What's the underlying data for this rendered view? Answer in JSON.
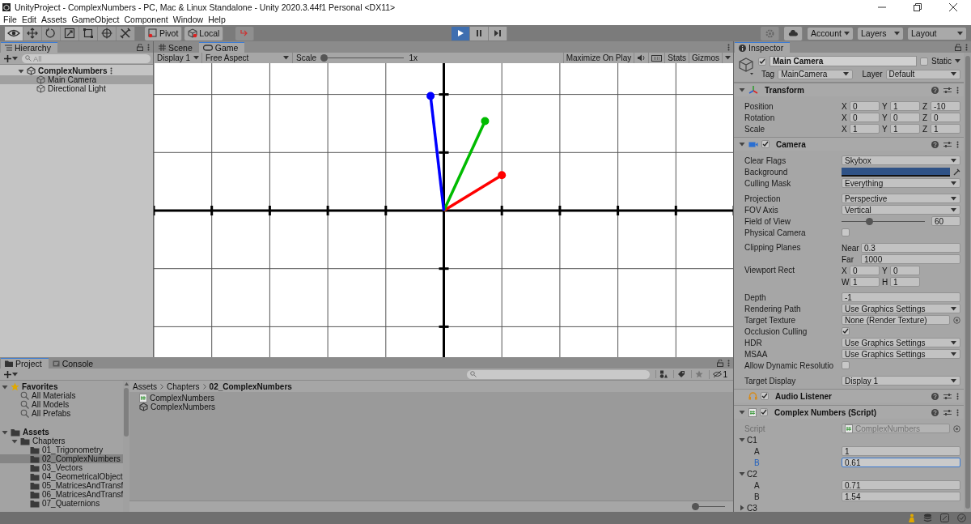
{
  "window": {
    "title": "UnityProject - ComplexNumbers - PC, Mac & Linux Standalone - Unity 2020.3.44f1 Personal <DX11>"
  },
  "menu": [
    "File",
    "Edit",
    "Assets",
    "GameObject",
    "Component",
    "Window",
    "Help"
  ],
  "toolbar": {
    "tools": [
      {
        "kind": "eye",
        "selected": true
      },
      {
        "kind": "move",
        "selected": false
      },
      {
        "kind": "rotate",
        "selected": false
      },
      {
        "kind": "scale",
        "selected": false
      },
      {
        "kind": "rect",
        "selected": false
      },
      {
        "kind": "transform",
        "selected": false
      },
      {
        "kind": "custom",
        "selected": false
      }
    ],
    "pivot": "Pivot",
    "local": "Local",
    "play": [
      {
        "kind": "play",
        "selected": true
      },
      {
        "kind": "pause",
        "selected": false
      },
      {
        "kind": "step",
        "selected": false
      }
    ],
    "menus": [
      "Account",
      "Layers",
      "Layout"
    ]
  },
  "hierarchy": {
    "tab": "Hierarchy",
    "search_placeholder": "All",
    "tree": [
      {
        "label": "ComplexNumbers",
        "kind": "scene",
        "expanded": true,
        "selected": false,
        "children": [
          {
            "label": "Main Camera",
            "kind": "object",
            "selected": true
          },
          {
            "label": "Directional Light",
            "kind": "object",
            "selected": false
          }
        ]
      }
    ]
  },
  "game": {
    "tabs": [
      {
        "label": "Scene",
        "kind": "grid",
        "selected": false
      },
      {
        "label": "Game",
        "kind": "gamepad",
        "selected": true
      }
    ],
    "display": "Display 1",
    "aspect": "Free Aspect",
    "scale_label": "Scale",
    "scale": {
      "level": 0
    },
    "scale_value": "1x",
    "maximize": "Maximize On Play",
    "stats": "Stats",
    "gizmos": "Gizmos"
  },
  "inspector": {
    "tab": "Inspector",
    "object": {
      "active": true,
      "name": "Main Camera",
      "static": false,
      "static_label": "Static",
      "tag_label": "Tag",
      "tag": "MainCamera",
      "layer_label": "Layer",
      "layer": "Default"
    },
    "components": [
      {
        "title": "Transform",
        "kind": "transform",
        "expanded": true,
        "sections": [
          {
            "rows": [
              {
                "kind": "vector",
                "label": "Position",
                "axes": [
                  {
                    "axis": "X",
                    "value": "0"
                  },
                  {
                    "axis": "Y",
                    "value": "1"
                  },
                  {
                    "axis": "Z",
                    "value": "-10"
                  }
                ]
              },
              {
                "kind": "vector",
                "label": "Rotation",
                "axes": [
                  {
                    "axis": "X",
                    "value": "0"
                  },
                  {
                    "axis": "Y",
                    "value": "0"
                  },
                  {
                    "axis": "Z",
                    "value": "0"
                  }
                ]
              },
              {
                "kind": "vector",
                "label": "Scale",
                "axes": [
                  {
                    "axis": "X",
                    "value": "1"
                  },
                  {
                    "axis": "Y",
                    "value": "1"
                  },
                  {
                    "axis": "Z",
                    "value": "1"
                  }
                ]
              }
            ]
          }
        ]
      },
      {
        "title": "Camera",
        "kind": "camera",
        "enabled": true,
        "expanded": true,
        "sections": [
          {
            "rows": [
              {
                "kind": "dropdown",
                "label": "Clear Flags",
                "value": "Skybox"
              },
              {
                "kind": "color",
                "label": "Background",
                "color": "#2f5286"
              },
              {
                "kind": "dropdown",
                "label": "Culling Mask",
                "value": "Everything"
              }
            ]
          },
          {
            "rows": [
              {
                "kind": "dropdown",
                "label": "Projection",
                "value": "Perspective"
              },
              {
                "kind": "dropdown",
                "label": "FOV Axis",
                "value": "Vertical"
              },
              {
                "kind": "slider",
                "label": "Field of View",
                "level": 0.33,
                "value": "60"
              },
              {
                "kind": "checkbox",
                "label": "Physical Camera",
                "checked": false
              }
            ]
          },
          {
            "rows": [
              {
                "kind": "pair",
                "label": "Clipping Planes",
                "fields": [
                  {
                    "label": "Near",
                    "value": "0.3"
                  },
                  {
                    "label": "Far",
                    "value": "1000"
                  }
                ]
              },
              {
                "kind": "rect",
                "label": "Viewport Rect",
                "fields": [
                  {
                    "label": "X",
                    "value": "0"
                  },
                  {
                    "label": "Y",
                    "value": "0"
                  },
                  {
                    "label": "W",
                    "value": "1"
                  },
                  {
                    "label": "H",
                    "value": "1"
                  }
                ]
              }
            ]
          },
          {
            "rows": [
              {
                "kind": "field",
                "label": "Depth",
                "value": "-1",
                "focused": false
              },
              {
                "kind": "dropdown",
                "label": "Rendering Path",
                "value": "Use Graphics Settings"
              },
              {
                "kind": "object",
                "label": "Target Texture",
                "value": "None (Render Texture)",
                "disabled": false
              },
              {
                "kind": "checkbox",
                "label": "Occlusion Culling",
                "checked": true
              },
              {
                "kind": "dropdown",
                "label": "HDR",
                "value": "Use Graphics Settings"
              },
              {
                "kind": "dropdown",
                "label": "MSAA",
                "value": "Use Graphics Settings"
              },
              {
                "kind": "checkbox",
                "label": "Allow Dynamic Resolutio",
                "checked": false
              }
            ]
          },
          {
            "rows": [
              {
                "kind": "dropdown",
                "label": "Target Display",
                "value": "Display 1"
              }
            ]
          }
        ]
      },
      {
        "title": "Audio Listener",
        "kind": "audio",
        "enabled": true
      },
      {
        "title": "Complex Numbers (Script)",
        "kind": "script",
        "enabled": true,
        "expanded": true,
        "sections": [
          {
            "rows": [
              {
                "kind": "object",
                "label": "Script",
                "value": "ComplexNumbers",
                "disabled": true
              },
              {
                "kind": "foldout",
                "label": "C1",
                "expanded": true,
                "children": [
                  {
                    "kind": "field",
                    "label": "A",
                    "value": "1",
                    "focused": false
                  },
                  {
                    "kind": "field",
                    "label": "B",
                    "value": "0.61",
                    "focused": true
                  }
                ]
              },
              {
                "kind": "foldout",
                "label": "C2",
                "expanded": true,
                "children": [
                  {
                    "kind": "field",
                    "label": "A",
                    "value": "0.71",
                    "focused": false
                  },
                  {
                    "kind": "field",
                    "label": "B",
                    "value": "1.54",
                    "focused": false
                  }
                ]
              },
              {
                "kind": "foldout",
                "label": "C3",
                "expanded": false
              }
            ]
          }
        ]
      }
    ]
  },
  "project": {
    "tabs": [
      {
        "label": "Project",
        "selected": true
      },
      {
        "label": "Console",
        "selected": false
      }
    ],
    "tree": [
      {
        "label": "Favorites",
        "kind": "favorites",
        "expanded": true,
        "selected": false,
        "children": [
          {
            "label": "All Materials",
            "kind": "search",
            "selected": false
          },
          {
            "label": "All Models",
            "kind": "search",
            "selected": false
          },
          {
            "label": "All Prefabs",
            "kind": "search",
            "selected": false
          }
        ]
      },
      {
        "label": "Assets",
        "kind": "folder",
        "expanded": true,
        "selected": false,
        "children": [
          {
            "label": "Chapters",
            "kind": "folder",
            "expanded": true,
            "selected": false,
            "children": [
              {
                "label": "01_Trigonometry",
                "kind": "folder",
                "selected": false
              },
              {
                "label": "02_ComplexNumbers",
                "kind": "folder",
                "selected": true
              },
              {
                "label": "03_Vectors",
                "kind": "folder",
                "selected": false
              },
              {
                "label": "04_GeometricalObject",
                "kind": "folder",
                "selected": false
              },
              {
                "label": "05_MatricesAndTransf",
                "kind": "folder",
                "selected": false
              },
              {
                "label": "06_MatricesAndTransf",
                "kind": "folder",
                "selected": false
              },
              {
                "label": "07_Quaternions",
                "kind": "folder",
                "selected": false
              }
            ]
          }
        ]
      }
    ],
    "breadcrumb": [
      "Assets",
      "Chapters",
      "02_ComplexNumbers"
    ],
    "files": [
      {
        "label": "ComplexNumbers",
        "kind": "script"
      },
      {
        "label": "ComplexNumbers",
        "kind": "scene"
      }
    ],
    "hidden_count": "1",
    "size": {
      "level": 0
    }
  }
}
